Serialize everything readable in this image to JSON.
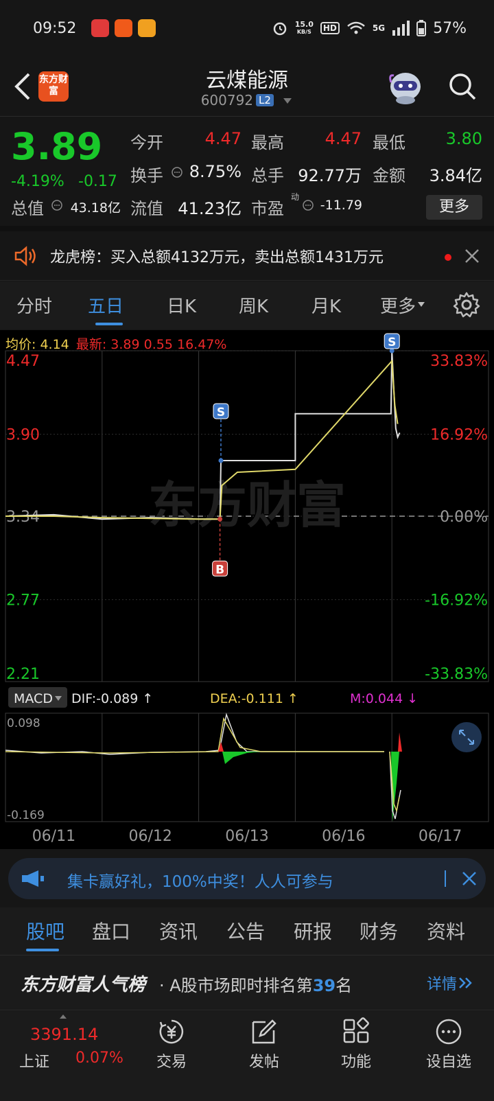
{
  "status": {
    "time": "09:52",
    "net_speed_value": "15.0",
    "net_speed_unit": "KB/S",
    "hd": "HD",
    "network": "5G",
    "battery": "57%"
  },
  "header": {
    "logo_text": "东方财富",
    "stock_name": "云煤能源",
    "stock_code": "600792",
    "level_badge": "L2"
  },
  "quote": {
    "price": "3.89",
    "change_pct": "-4.19%",
    "change_amt": "-0.17",
    "open_label": "今开",
    "open_value": "4.47",
    "high_label": "最高",
    "high_value": "4.47",
    "low_label": "最低",
    "low_value": "3.80",
    "turnover_label": "换手",
    "turnover_value": "8.75%",
    "volume_label": "总手",
    "volume_value": "92.77万",
    "amount_label": "金额",
    "amount_value": "3.84亿",
    "mktcap_label": "总值",
    "mktcap_value": "43.18亿",
    "float_label": "流值",
    "float_value": "41.23亿",
    "pe_label": "市盈",
    "pe_superscript": "动",
    "pe_value": "-11.79",
    "more_button": "更多"
  },
  "notice": {
    "text": "龙虎榜：买入总额4132万元，卖出总额1431万元"
  },
  "period_tabs": [
    "分时",
    "五日",
    "日K",
    "周K",
    "月K",
    "更多"
  ],
  "chart_info": {
    "avg_label": "均价:",
    "avg_value": "4.14",
    "latest_label": "最新:",
    "latest_value": "3.89",
    "latest_change": "0.55",
    "latest_pct": "16.47%"
  },
  "chart_data": {
    "type": "line",
    "y_left_ticks": [
      "4.47",
      "3.90",
      "3.34",
      "2.77",
      "2.21"
    ],
    "y_right_ticks": [
      "33.83%",
      "16.92%",
      "0.00%",
      "-16.92%",
      "-33.83%"
    ],
    "x_labels": [
      "06/11",
      "06/12",
      "06/13",
      "06/16",
      "06/17"
    ],
    "ylim": [
      2.21,
      4.47
    ],
    "reference_price": 3.34,
    "watermark": "东方财富",
    "series": [
      {
        "color": "#e0e0e0",
        "points": [
          [
            0,
            3.34
          ],
          [
            0.5,
            3.35
          ],
          [
            1,
            3.32
          ],
          [
            1.5,
            3.33
          ],
          [
            2,
            3.32
          ],
          [
            2.22,
            3.32
          ],
          [
            2.23,
            3.72
          ],
          [
            3,
            3.72
          ],
          [
            3,
            4.04
          ],
          [
            3.99,
            4.04
          ],
          [
            4,
            4.47
          ],
          [
            4.04,
            3.94
          ],
          [
            4.06,
            3.88
          ],
          [
            4.08,
            3.91
          ]
        ]
      },
      {
        "color": "#e0d86a",
        "points": [
          [
            0,
            3.34
          ],
          [
            0.5,
            3.34
          ],
          [
            1,
            3.33
          ],
          [
            2,
            3.32
          ],
          [
            2.22,
            3.32
          ],
          [
            2.24,
            3.55
          ],
          [
            2.4,
            3.64
          ],
          [
            3,
            3.66
          ],
          [
            4,
            4.4
          ],
          [
            4.03,
            4.1
          ],
          [
            4.06,
            3.97
          ]
        ]
      }
    ],
    "trade_markers": [
      {
        "label": "S",
        "x": 2.23,
        "price": 3.72
      },
      {
        "label": "B",
        "x": 2.22,
        "price": 3.32
      },
      {
        "label": "S",
        "x": 4.0,
        "price": 4.47
      }
    ]
  },
  "macd": {
    "selector": "MACD",
    "dif": "DIF:-0.089",
    "dea": "DEA:-0.111",
    "m": "M:0.044",
    "top_tick": "0.098",
    "bottom_tick": "-0.169"
  },
  "banner": {
    "text": "集卡赢好礼，100%中奖！人人可参与"
  },
  "sub_tabs": [
    "股吧",
    "盘口",
    "资讯",
    "公告",
    "研报",
    "财务",
    "资料"
  ],
  "ranking": {
    "brand": "东方财富人气榜",
    "text_prefix": "· A股市场即时排名第",
    "rank": "39",
    "text_suffix": "名",
    "detail": "详情"
  },
  "bottom_nav": {
    "index_value": "3391.14",
    "index_name": "上证",
    "index_pct": "0.07%",
    "items": [
      "交易",
      "发帖",
      "功能",
      "设自选"
    ]
  }
}
